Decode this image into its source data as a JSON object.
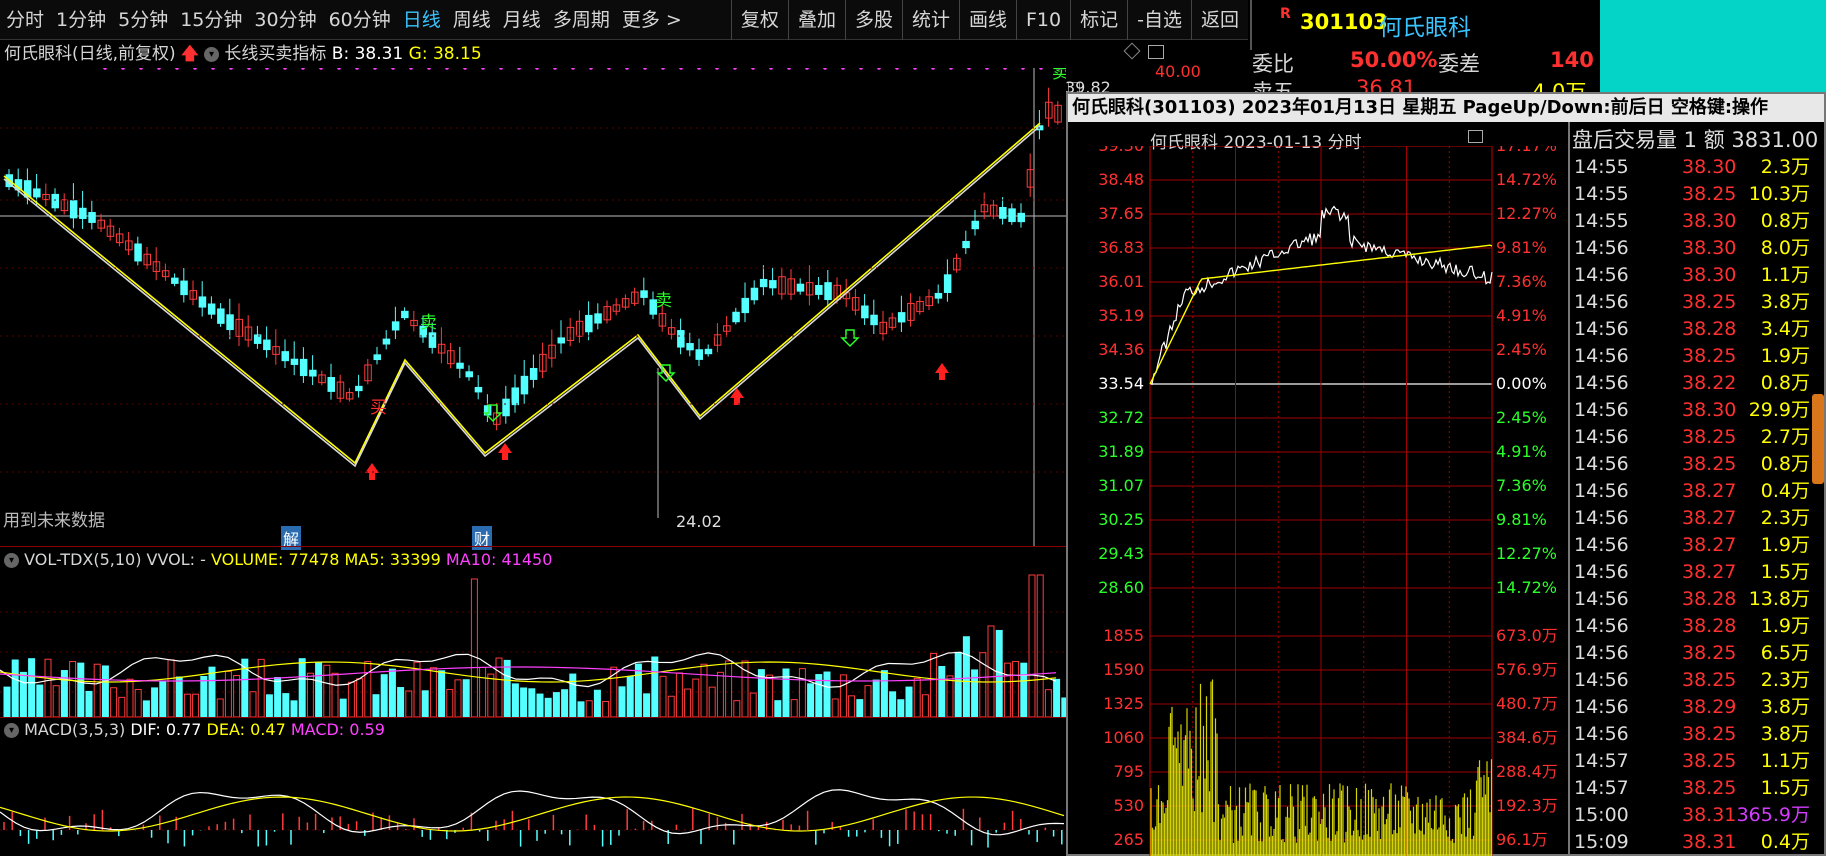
{
  "toolbar": {
    "periods": [
      "分时",
      "1分钟",
      "5分钟",
      "15分钟",
      "30分钟",
      "60分钟",
      "日线",
      "周线",
      "月线",
      "多周期",
      "更多 >"
    ],
    "active_period": "日线",
    "tools": [
      "复权",
      "叠加",
      "多股",
      "统计",
      "画线",
      "F10",
      "标记",
      "-自选",
      "返回"
    ]
  },
  "stock": {
    "badge": "R",
    "code": "301103",
    "name": "何氏眼科",
    "weibi_label": "委比",
    "weibi_value": "50.00%",
    "weicha_label": "委差",
    "weicha_value": "140",
    "sell5_label": "卖五",
    "sell5_value": "36.81",
    "sell5_vol": "4.0万"
  },
  "main_chart": {
    "title": "何氏眼科(日线,前复权)",
    "indicator": "长线买卖指标",
    "b_label": "B:",
    "b_value": "38.31",
    "g_label": "G:",
    "g_value": "38.15",
    "price_top": "40.00",
    "high_label": "39.82",
    "low_label": "24.02",
    "future_note": "用到未来数据",
    "marker_jie": "解",
    "marker_cai": "财",
    "signal_buy": "买",
    "signal_sell": "卖"
  },
  "volume_panel": {
    "name": "VOL-TDX(5,10)",
    "vvol": "VVOL: -",
    "volume": "VOLUME: 77478",
    "ma5": "MA5: 33399",
    "ma10": "MA10: 41450"
  },
  "macd_panel": {
    "name": "MACD(3,5,3)",
    "dif": "DIF: 0.77",
    "dea": "DEA: 0.47",
    "macd": "MACD: 0.59"
  },
  "popup": {
    "title": "何氏眼科(301103) 2023年01月13日 星期五 PageUp/Down:前后日 空格键:操作",
    "chart_title": "何氏眼科  2023-01-13 分时",
    "price_labels": [
      "39.30",
      "38.48",
      "37.65",
      "36.83",
      "36.01",
      "35.19",
      "34.36",
      "33.54",
      "32.72",
      "31.89",
      "31.07",
      "30.25",
      "29.43",
      "28.60"
    ],
    "pct_labels": [
      "17.17%",
      "14.72%",
      "12.27%",
      "9.81%",
      "7.36%",
      "4.91%",
      "2.45%",
      "0.00%",
      "2.45%",
      "4.91%",
      "7.36%",
      "9.81%",
      "12.27%",
      "14.72%"
    ],
    "vol_labels": [
      "1855",
      "1590",
      "1325",
      "1060",
      "795",
      "530",
      "265"
    ],
    "vol_amount_labels": [
      "673.0万",
      "576.9万",
      "480.7万",
      "384.6万",
      "288.4万",
      "192.3万",
      "96.1万"
    ],
    "table_header": "盘后交易量 1 额 3831.00",
    "trades": [
      {
        "time": "14:55",
        "price": "38.30",
        "vol": "2.3万",
        "c": "y"
      },
      {
        "time": "14:55",
        "price": "38.25",
        "vol": "10.3万",
        "c": "y"
      },
      {
        "time": "14:55",
        "price": "38.30",
        "vol": "0.8万",
        "c": "y"
      },
      {
        "time": "14:56",
        "price": "38.30",
        "vol": "8.0万",
        "c": "y"
      },
      {
        "time": "14:56",
        "price": "38.30",
        "vol": "1.1万",
        "c": "y"
      },
      {
        "time": "14:56",
        "price": "38.25",
        "vol": "3.8万",
        "c": "y"
      },
      {
        "time": "14:56",
        "price": "38.28",
        "vol": "3.4万",
        "c": "y"
      },
      {
        "time": "14:56",
        "price": "38.25",
        "vol": "1.9万",
        "c": "y"
      },
      {
        "time": "14:56",
        "price": "38.22",
        "vol": "0.8万",
        "c": "y"
      },
      {
        "time": "14:56",
        "price": "38.30",
        "vol": "29.9万",
        "c": "y"
      },
      {
        "time": "14:56",
        "price": "38.25",
        "vol": "2.7万",
        "c": "y"
      },
      {
        "time": "14:56",
        "price": "38.25",
        "vol": "0.8万",
        "c": "y"
      },
      {
        "time": "14:56",
        "price": "38.27",
        "vol": "0.4万",
        "c": "y"
      },
      {
        "time": "14:56",
        "price": "38.27",
        "vol": "2.3万",
        "c": "y"
      },
      {
        "time": "14:56",
        "price": "38.27",
        "vol": "1.9万",
        "c": "y"
      },
      {
        "time": "14:56",
        "price": "38.27",
        "vol": "1.5万",
        "c": "y"
      },
      {
        "time": "14:56",
        "price": "38.28",
        "vol": "13.8万",
        "c": "y"
      },
      {
        "time": "14:56",
        "price": "38.28",
        "vol": "1.9万",
        "c": "y"
      },
      {
        "time": "14:56",
        "price": "38.25",
        "vol": "6.5万",
        "c": "y"
      },
      {
        "time": "14:56",
        "price": "38.25",
        "vol": "2.3万",
        "c": "y"
      },
      {
        "time": "14:56",
        "price": "38.29",
        "vol": "3.8万",
        "c": "y"
      },
      {
        "time": "14:56",
        "price": "38.25",
        "vol": "3.8万",
        "c": "y"
      },
      {
        "time": "14:57",
        "price": "38.25",
        "vol": "1.1万",
        "c": "y"
      },
      {
        "time": "14:57",
        "price": "38.25",
        "vol": "1.5万",
        "c": "y"
      },
      {
        "time": "15:00",
        "price": "38.31",
        "vol": "365.9万",
        "c": "m"
      },
      {
        "time": "15:09",
        "price": "38.31",
        "vol": "0.4万",
        "c": "y"
      }
    ]
  },
  "colors": {
    "up": "#ff3b3b",
    "down": "#54ffff",
    "ma_yellow": "#ffff00",
    "ma_white": "#ffffff",
    "ma_magenta": "#ff40ff",
    "grid": "#8b0000"
  }
}
